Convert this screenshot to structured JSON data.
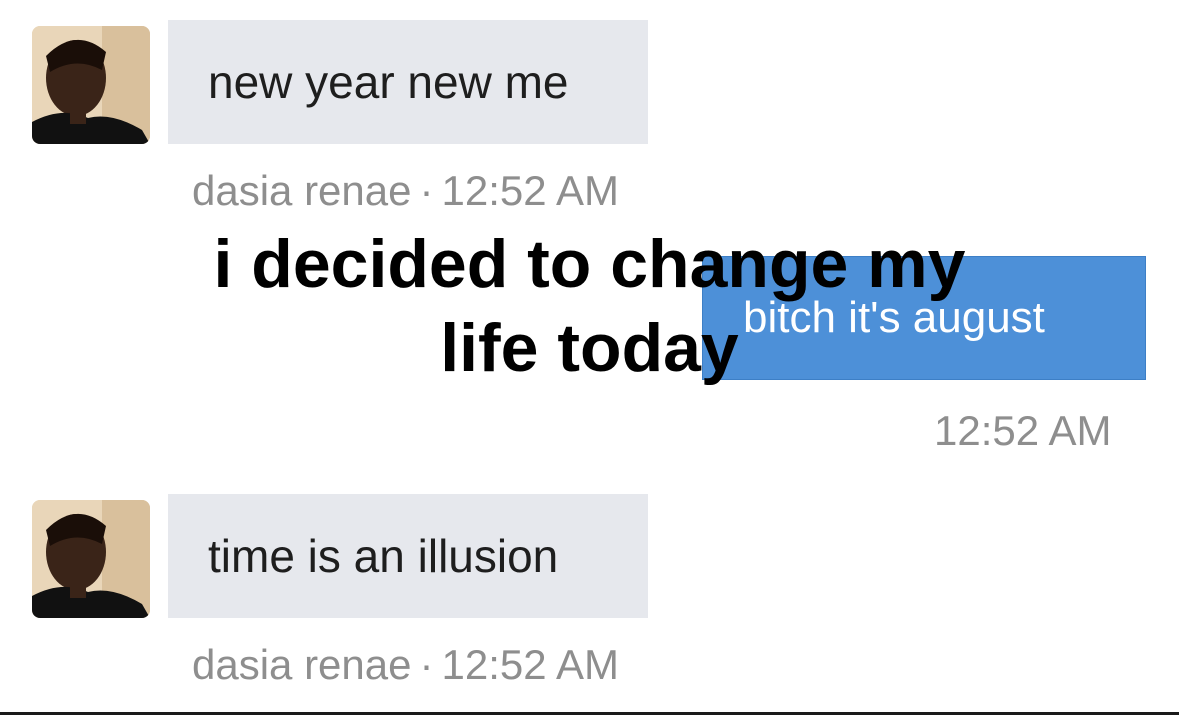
{
  "messages": [
    {
      "text": "new year new me",
      "sender": "dasia renae",
      "separator": "·",
      "time": "12:52 AM"
    },
    {
      "text": "bitch it's august",
      "time": "12:52 AM"
    },
    {
      "text": "time is an illusion",
      "sender": "dasia renae",
      "separator": "·",
      "time": "12:52 AM"
    }
  ],
  "overlay": {
    "line1": "i decided to change my",
    "line2": "life today"
  },
  "icons": {
    "avatar": "avatar-photo"
  },
  "colors": {
    "incoming_bubble": "#e6e8ed",
    "outgoing_bubble": "#4d90d8",
    "meta_text": "#8e8e8e",
    "overlay_text": "#000000"
  }
}
